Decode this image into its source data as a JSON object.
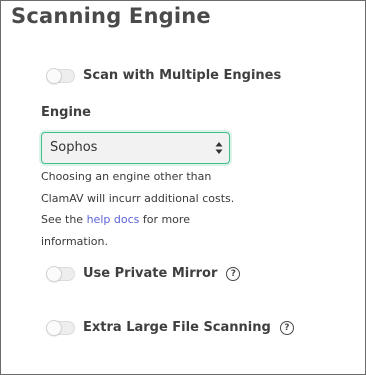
{
  "title": "Scanning Engine",
  "multiple_engines": {
    "label": "Scan with Multiple Engines",
    "enabled": false
  },
  "engine": {
    "label": "Engine",
    "selected": "Sophos",
    "border_color": "#3fbf8a"
  },
  "help_text": {
    "line1": "Choosing an engine other than",
    "line2": "ClamAV will incurr additional costs.",
    "line3_prefix": "See the",
    "link_text": "help docs",
    "line3_suffix": "for more",
    "line4": "information.",
    "link_color": "#5a63d6"
  },
  "private_mirror": {
    "label": "Use Private Mirror",
    "enabled": false,
    "help_icon_glyph": "?",
    "icon": "question-circle-icon"
  },
  "large_file_scanning": {
    "label": "Extra Large File Scanning",
    "enabled": false,
    "help_icon_glyph": "?",
    "icon": "question-circle-icon"
  }
}
